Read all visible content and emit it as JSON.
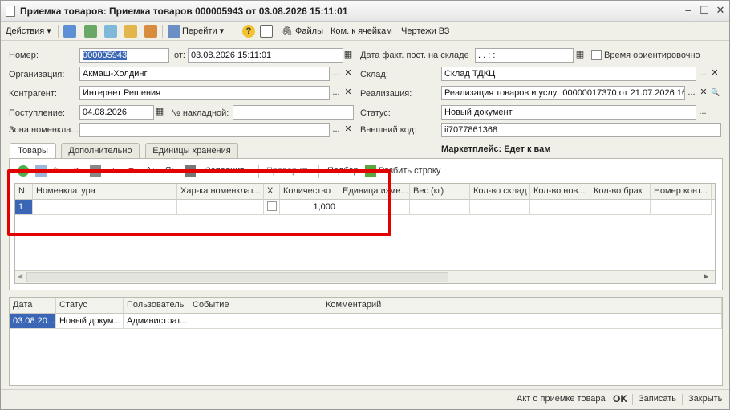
{
  "window": {
    "title": "Приемка товаров: Приемка товаров 000005943 от 03.08.2026 15:11:01",
    "min": "–",
    "max": "☐",
    "close": "✕"
  },
  "toolbar": {
    "actions_label": "Действия",
    "goto_label": "Перейти",
    "files_label": "Файлы",
    "cells_label": "Ком. к ячейкам",
    "drawings_label": "Чертежи ВЗ"
  },
  "form": {
    "number_label": "Номер:",
    "number_value": "000005943",
    "from_label": "от:",
    "from_value": "03.08.2026 15:11:01",
    "fact_date_label": "Дата факт. пост. на складе",
    "fact_date_value": " .  .     :  :",
    "approx_time_label": "Время ориентировочно",
    "org_label": "Организация:",
    "org_value": "Акмаш-Холдинг",
    "warehouse_label": "Склад:",
    "warehouse_value": "Склад ТДКЦ",
    "contractor_label": "Контрагент:",
    "contractor_value": "Интернет Решения",
    "sale_label": "Реализация:",
    "sale_value": "Реализация товаров и услуг 00000017370 от 21.07.2026 16:",
    "arrival_label": "Поступление:",
    "arrival_value": "04.08.2026",
    "invoice_label": "№ накладной:",
    "invoice_value": "",
    "status_label": "Статус:",
    "status_value": "Новый документ",
    "zone_label": "Зона номенкла...",
    "zone_value": "",
    "ext_code_label": "Внешний код:",
    "ext_code_value": "ii7077861368",
    "marketplace_text": "Маркетплейс: Едет к вам",
    "select_btn": "...",
    "clear_btn": "✕",
    "search_btn": "🔍"
  },
  "tabs": [
    {
      "label": "Товары"
    },
    {
      "label": "Дополнительно"
    },
    {
      "label": "Единицы хранения"
    }
  ],
  "goods_toolbar": {
    "fill_label": "Заполнить",
    "check_label": "Проверить",
    "pick_label": "Подбор",
    "split_label": "Разбить строку"
  },
  "goods_table": {
    "columns": [
      "N",
      "Номенклатура",
      "Хар-ка номенклат...",
      "X",
      "Количество",
      "Единица изме...",
      "Вес (кг)",
      "Кол-во склад",
      "Кол-во нов...",
      "Кол-во брак",
      "Номер конт..."
    ],
    "rows": [
      {
        "n": "1",
        "item": "",
        "char": "",
        "x": "",
        "qty": "1,000",
        "unit": "",
        "weight": "",
        "qty_wh": "",
        "qty_new": "",
        "qty_defect": "",
        "container": ""
      }
    ]
  },
  "history_table": {
    "columns": [
      "Дата",
      "Статус",
      "Пользователь",
      "Событие",
      "Комментарий"
    ],
    "rows": [
      {
        "date": "03.08.20...",
        "status": "Новый докум...",
        "user": "Администрат...",
        "event": "",
        "comment": ""
      }
    ]
  },
  "bottom": {
    "act_label": "Акт о приемке товара",
    "ok_label": "OK",
    "save_label": "Записать",
    "close_label": "Закрыть"
  },
  "colors": {
    "accent_selection": "#3a66b5",
    "highlight_box": "#e30000",
    "marketplace_text": "#222222"
  }
}
